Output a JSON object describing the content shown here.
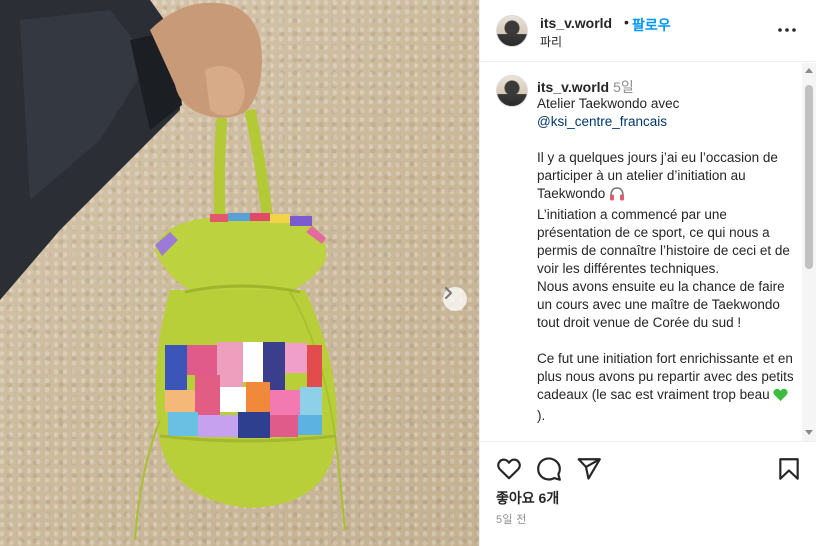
{
  "post": {
    "username": "its_v.world",
    "dot": "•",
    "follow_label": "팔로우",
    "location": "파리"
  },
  "caption": {
    "username": "its_v.world",
    "time": "5일",
    "line1": "Atelier Taekwondo avec",
    "mention": "@ksi_centre_francais",
    "para1_a": "Il y a quelques jours j’ai eu l’occasion de participer à un atelier d’initiation au Taekwondo",
    "para1_b": "L’initiation a commencé par une présentation de ce sport, ce qui nous a permis de connaître l’histoire de ceci et de voir les différentes techniques.",
    "para1_c": "Nous avons ensuite eu la chance de faire un cours avec une maître de Taekwondo tout droit venue de Corée du sud !",
    "para2_a": "Ce fut une initiation fort enrichissante et en plus nous avons pu repartir avec des petits cadeaux (le sac est vraiment trop beau",
    "para2_b": ")."
  },
  "actions": {
    "likes": "좋아요 6개",
    "timestamp": "5일 전"
  },
  "icons": {
    "more": "more-options-icon",
    "like": "heart-icon",
    "comment": "comment-icon",
    "share": "send-icon",
    "save": "bookmark-icon",
    "next": "chevron-right-icon",
    "headphones": "headphones-emoji",
    "green_heart": "green-heart-emoji"
  },
  "colors": {
    "follow": "#0095f6",
    "mention": "#00376b",
    "meta": "#8e8e8e",
    "bag": "#b9cf3a"
  }
}
